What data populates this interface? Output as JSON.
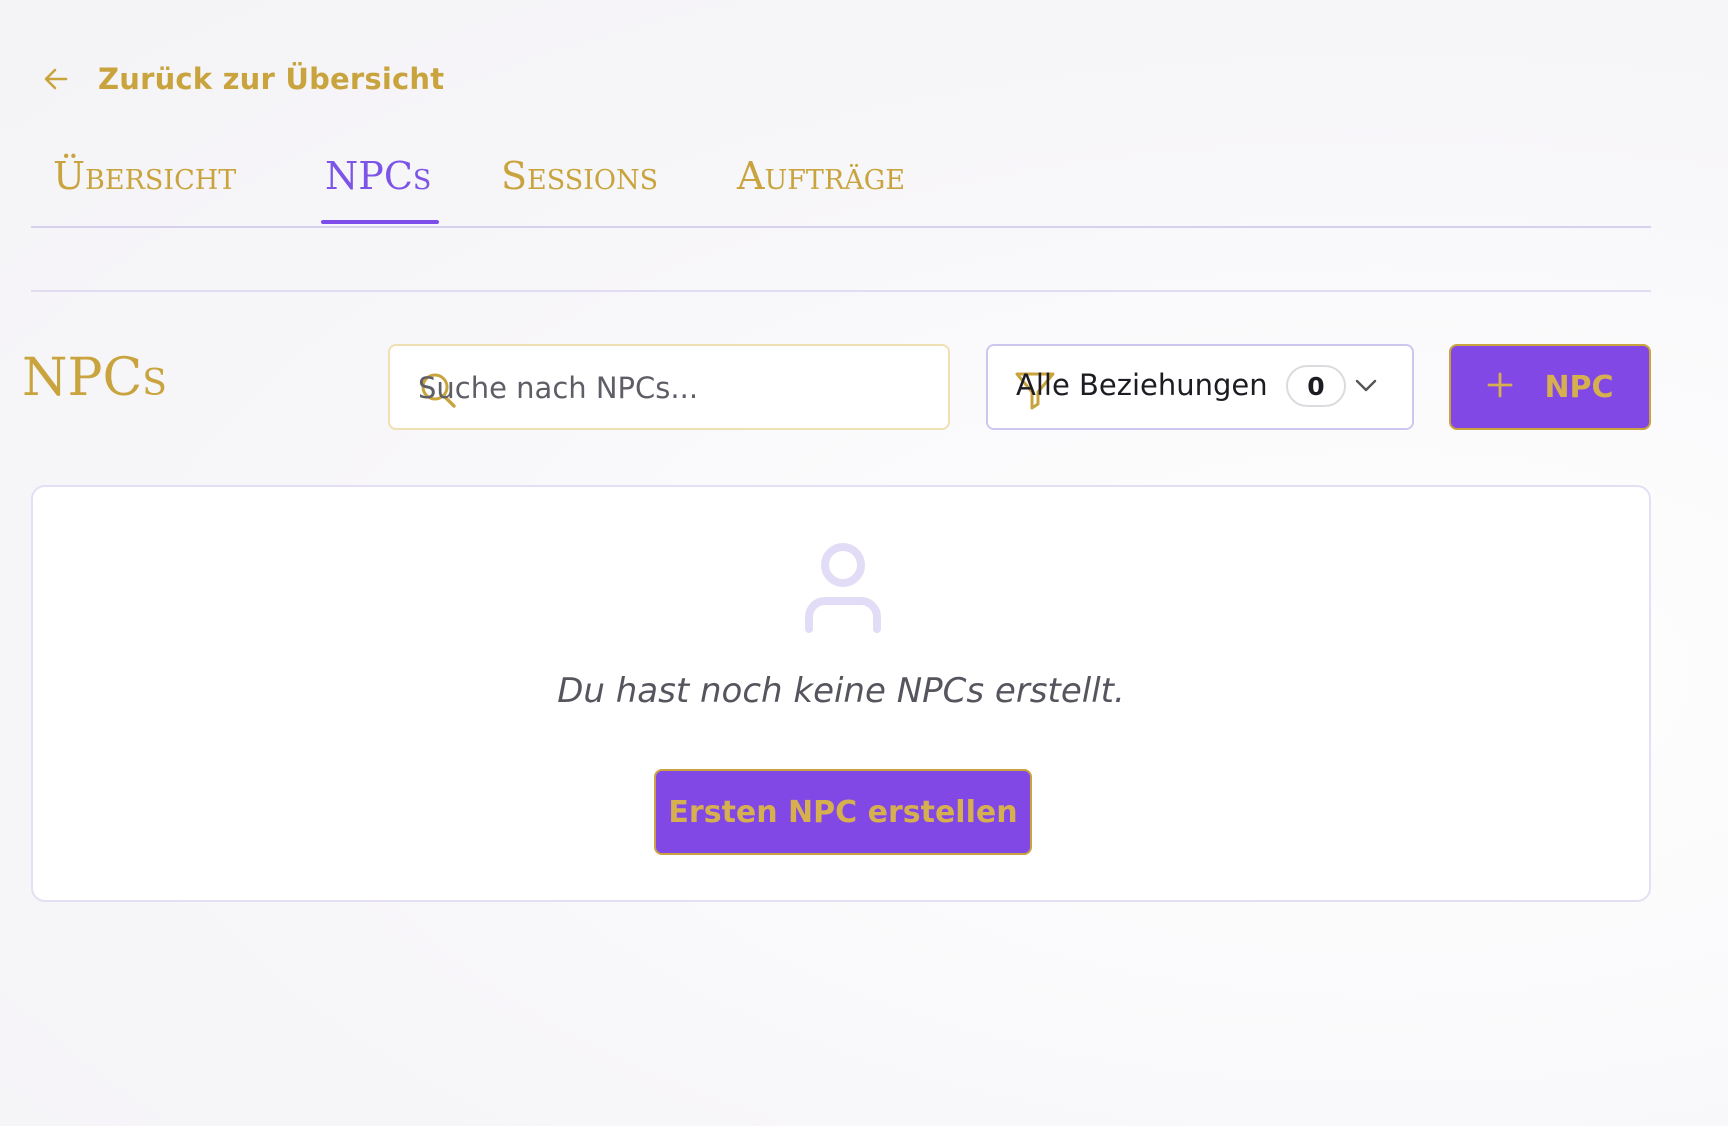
{
  "nav": {
    "back_label": "Zurück zur Übersicht"
  },
  "tabs": [
    {
      "label": "Übersicht",
      "active": false
    },
    {
      "label": "NPCs",
      "active": true
    },
    {
      "label": "Sessions",
      "active": false
    },
    {
      "label": "Aufträge",
      "active": false
    }
  ],
  "section": {
    "title": "NPCs"
  },
  "search": {
    "placeholder": "Suche nach NPCs...",
    "value": ""
  },
  "filter": {
    "label": "Alle Beziehungen",
    "count": "0"
  },
  "actions": {
    "add_label": "NPC"
  },
  "empty_state": {
    "message": "Du hast noch keine NPCs erstellt.",
    "button_label": "Ersten NPC erstellen"
  },
  "colors": {
    "accent_gold": "#c9a43e",
    "accent_purple": "#8248e6",
    "tab_active": "#7c55e6"
  },
  "icons": [
    "arrow-left-icon",
    "search-icon",
    "filter-icon",
    "chevron-down-icon",
    "plus-icon",
    "user-icon"
  ]
}
